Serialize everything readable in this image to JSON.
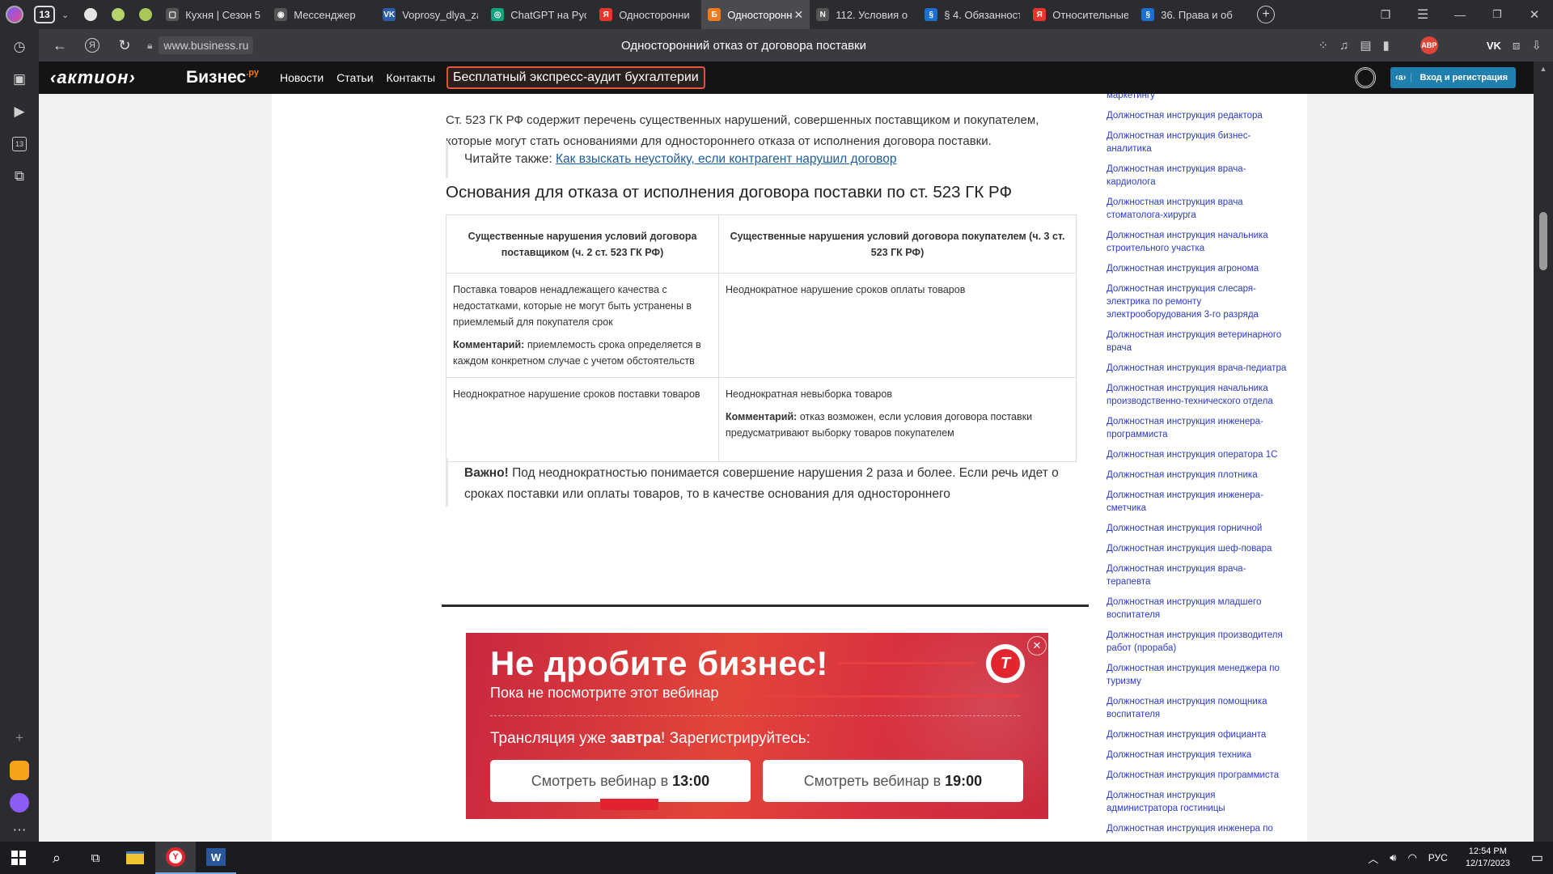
{
  "tabs": {
    "counter": "13",
    "items": [
      {
        "title": "Кухня | Сезон 5",
        "fav_color": "#555",
        "fav_glyph": "▢"
      },
      {
        "title": "Мессенджер",
        "fav_color": "#555",
        "fav_glyph": "◉"
      },
      {
        "title": "Voprosy_dlya_za",
        "fav_color": "#2b5ea8",
        "fav_glyph": "VK"
      },
      {
        "title": "ChatGPT на Рус",
        "fav_color": "#10a37f",
        "fav_glyph": "◎"
      },
      {
        "title": "Односторонни",
        "fav_color": "#e8352b",
        "fav_glyph": "Я"
      },
      {
        "title": "Односторонн",
        "fav_color": "#f07c19",
        "fav_glyph": "Б",
        "active": true
      },
      {
        "title": "112. Условия о",
        "fav_color": "#555",
        "fav_glyph": "N"
      },
      {
        "title": "§ 4. Обязанност",
        "fav_color": "#1a6fd0",
        "fav_glyph": "§"
      },
      {
        "title": "Относительные",
        "fav_color": "#e8352b",
        "fav_glyph": "Я"
      },
      {
        "title": "36. Права и об",
        "fav_color": "#1a6fd0",
        "fav_glyph": "§"
      }
    ],
    "close_glyph": "✕",
    "new_tab": "+"
  },
  "address": {
    "url": "www.business.ru",
    "title": "Односторонний отказ от договора поставки",
    "abp": "ABP"
  },
  "site": {
    "logo_aktion": "‹актион›",
    "logo_biz": "Бизнес",
    "logo_ru": ".ру",
    "nav": [
      "Новости",
      "Статьи",
      "Контакты"
    ],
    "promo": "Бесплатный экспресс-аудит бухгалтерии",
    "login_badge": "‹a›",
    "login": "Вход и регистрация"
  },
  "article": {
    "para1": "Ст. 523 ГК РФ содержит перечень существенных нарушений, совершенных поставщиком и покупателем, которые могут стать основаниями для одностороннего отказа от исполнения договора поставки.",
    "read_also_label": "Читайте также:",
    "read_also_link": "Как взыскать неустойку, если контрагент нарушил договор",
    "heading": "Основания для отказа от исполнения договора поставки по ст. 523 ГК РФ",
    "table": {
      "headers": [
        "Существенные нарушения условий договора поставщиком (ч. 2 ст. 523 ГК РФ)",
        "Существенные нарушения условий договора покупателем (ч. 3 ст. 523 ГК РФ)"
      ],
      "row1_left_text": "Поставка товаров ненадлежащего качества с недостатками, которые не могут быть устранены в приемлемый для покупателя срок",
      "row1_left_comment_label": "Комментарий:",
      "row1_left_comment": "приемлемость срока определяется в каждом конкретном случае с учетом обстоятельств",
      "row1_right_text": "Неоднократное нарушение сроков оплаты товаров",
      "row2_left_text": "Неоднократное нарушение сроков поставки товаров",
      "row2_right_text": "Неоднократная невыборка товаров",
      "row2_right_comment_label": "Комментарий:",
      "row2_right_comment": "отказ возможен, если условия договора поставки предусматривают выборку товаров покупателем"
    },
    "important_label": "Важно!",
    "important_text": "Под неоднократностью понимается совершение нарушения 2 раза и более. Если речь идет о сроках поставки или оплаты товаров, то в качестве основания для одностороннего"
  },
  "sidebar": {
    "partial_top": "маркетингу",
    "links": [
      "Должностная инструкция редактора",
      "Должностная инструкция бизнес-аналитика",
      "Должностная инструкция врача-кардиолога",
      "Должностная инструкция врача стоматолога-хирурга",
      "Должностная инструкция начальника строительного участка",
      "Должностная инструкция агронома",
      "Должностная инструкция слесаря-электрика по ремонту электрооборудования 3-го разряда",
      "Должностная инструкция ветеринарного врача",
      "Должностная инструкция врача-педиатра",
      "Должностная инструкция начальника производственно-технического отдела",
      "Должностная инструкция инженера-программиста",
      "Должностная инструкция оператора 1С",
      "Должностная инструкция плотника",
      "Должностная инструкция инженера-сметчика",
      "Должностная инструкция горничной",
      "Должностная инструкция шеф-повара",
      "Должностная инструкция врача-терапевта",
      "Должностная инструкция младшего воспитателя",
      "Должностная инструкция производителя работ (прораба)",
      "Должностная инструкция менеджера по туризму",
      "Должностная инструкция помощника воспитателя",
      "Должностная инструкция официанта",
      "Должностная инструкция техника",
      "Должностная инструкция программиста",
      "Должностная инструкция администратора гостиницы"
    ],
    "partial_bottom": "Должностная инструкция инженера по"
  },
  "ad": {
    "title": "Не дробите бизнес!",
    "subtitle": "Пока не посмотрите этот вебинар",
    "cta_pre": "Трансляция уже ",
    "cta_bold": "завтра",
    "cta_post": "! Зарегистрируйтесь:",
    "btn1_pre": "Смотреть вебинар в ",
    "btn1_time": "13:00",
    "btn2_pre": "Смотреть вебинар в ",
    "btn2_time": "19:00",
    "close": "✕",
    "badge": "Т"
  },
  "taskbar": {
    "lang": "РУС",
    "time": "12:54 PM",
    "date": "12/17/2023"
  },
  "icons": [
    "menu-icon",
    "history-icon",
    "collections-icon",
    "video-icon",
    "tabs-counter-icon",
    "screenshot-icon",
    "plus-icon",
    "mail-icon",
    "alice-icon",
    "more-icon",
    "back-icon",
    "yandex-icon",
    "reload-icon",
    "lock-icon",
    "extensions-icon",
    "headphones-icon",
    "reader-icon",
    "bookmark-icon",
    "vk-icon",
    "downloads-icon",
    "download-icon",
    "search-icon",
    "windows-icon",
    "taskview-icon",
    "explorer-icon",
    "yandex-browser-icon",
    "word-icon",
    "notification-icon",
    "wifi-icon",
    "volume-icon",
    "chevron-up-icon"
  ]
}
